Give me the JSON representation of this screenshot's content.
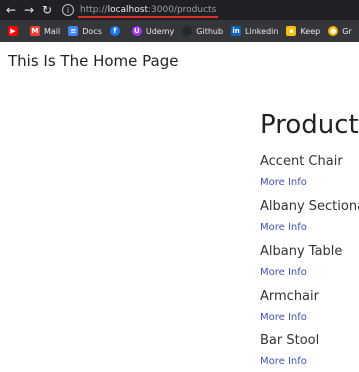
{
  "browser": {
    "url_prefix": "http://",
    "url_host": "localhost",
    "url_rest": ":3000/products"
  },
  "bookmarks": [
    {
      "label": "Mail",
      "icon": "gmail-icon",
      "color": "#ea4335"
    },
    {
      "label": "Docs",
      "icon": "docs-icon",
      "color": "#4285f4"
    },
    {
      "label": "",
      "icon": "facebook-icon",
      "color": "#1877f2"
    },
    {
      "label": "Udemy",
      "icon": "udemy-icon",
      "color": "#a435f0"
    },
    {
      "label": "Github",
      "icon": "github-icon",
      "color": "#24292e"
    },
    {
      "label": "Linkedin",
      "icon": "linkedin-icon",
      "color": "#0a66c2"
    },
    {
      "label": "Keep",
      "icon": "keep-icon",
      "color": "#fbbc04"
    },
    {
      "label": "Gr",
      "icon": "gr-icon",
      "color": "#f4b400"
    }
  ],
  "page": {
    "home_title": "This Is The Home Page",
    "products_title": "Products",
    "more_info_label": "More Info",
    "products": [
      "Accent Chair",
      "Albany Sectional",
      "Albany Table",
      "Armchair",
      "Bar Stool"
    ]
  }
}
